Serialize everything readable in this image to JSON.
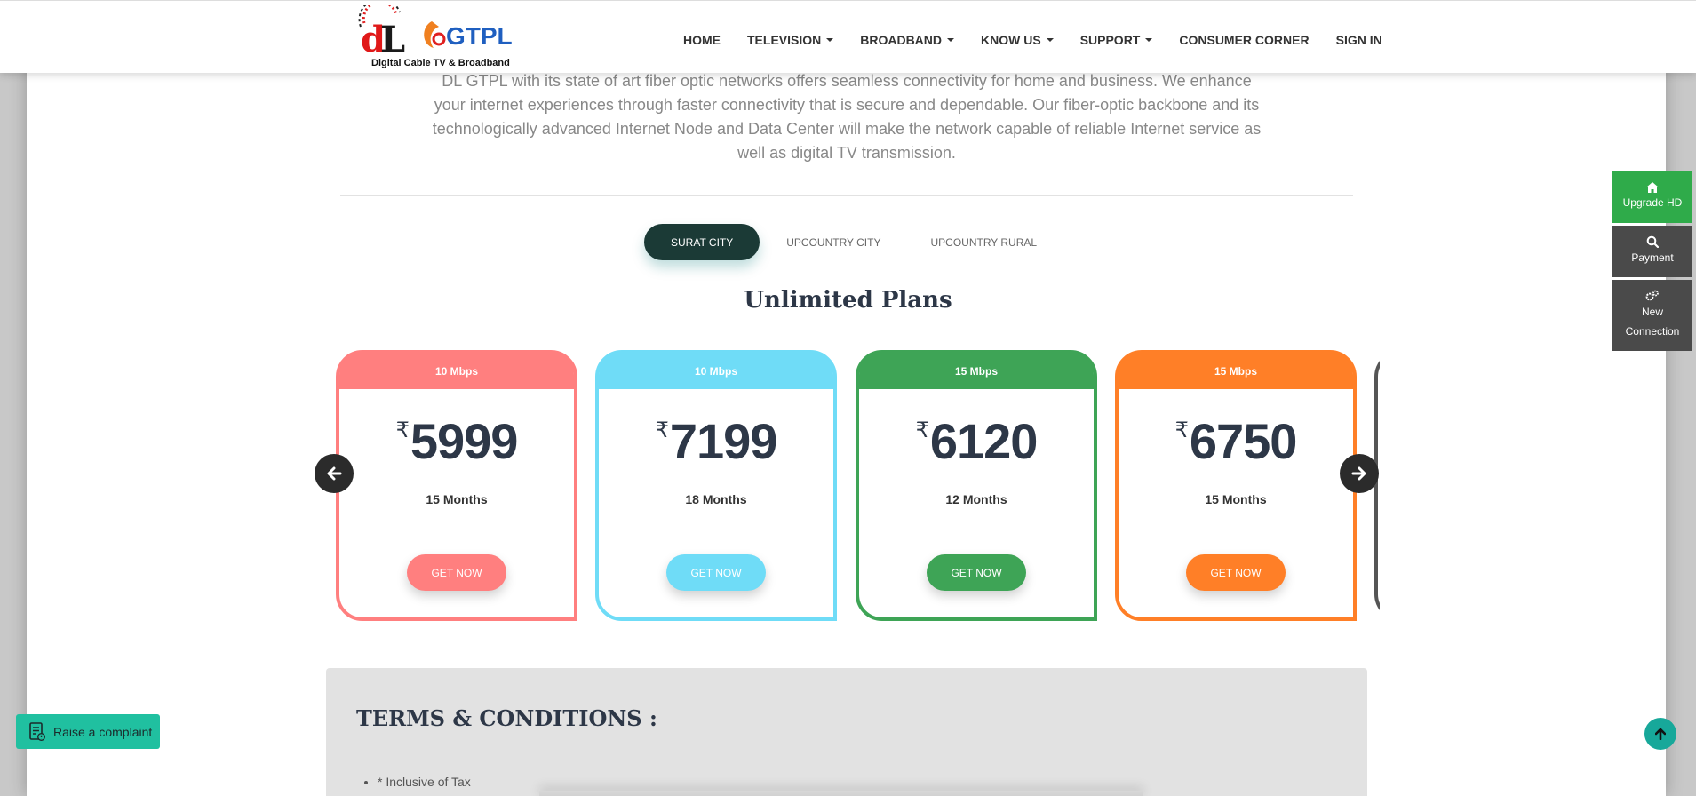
{
  "header": {
    "logo_tagline": "Digital Cable TV & Broadband",
    "logo_text": "GTPL",
    "logo_mark": "dL",
    "nav": [
      {
        "label": "HOME",
        "dropdown": false
      },
      {
        "label": "TELEVISION",
        "dropdown": true
      },
      {
        "label": "BROADBAND",
        "dropdown": true
      },
      {
        "label": "KNOW US",
        "dropdown": true
      },
      {
        "label": "SUPPORT",
        "dropdown": true
      },
      {
        "label": "CONSUMER CORNER",
        "dropdown": false
      },
      {
        "label": "SIGN IN",
        "dropdown": false
      }
    ]
  },
  "intro": "DL GTPL with its state of art fiber optic networks offers seamless connectivity for home and business. We enhance your internet experiences through faster connectivity that is secure and dependable. Our fiber-optic backbone and its technologically advanced Internet Node and Data Center will make the network capable of reliable Internet service as well as digital TV transmission.",
  "tabs": [
    {
      "label": "SURAT CITY",
      "active": true
    },
    {
      "label": "UPCOUNTRY CITY",
      "active": false
    },
    {
      "label": "UPCOUNTRY RURAL",
      "active": false
    }
  ],
  "plans_title": "Unlimited Plans",
  "plans": [
    {
      "speed": "10 Mbps",
      "currency": "₹",
      "price": "5999",
      "duration": "15 Months",
      "button": "GET NOW",
      "color": "#ff7f7f"
    },
    {
      "speed": "10 Mbps",
      "currency": "₹",
      "price": "7199",
      "duration": "18 Months",
      "button": "GET NOW",
      "color": "#6fdcf7"
    },
    {
      "speed": "15 Mbps",
      "currency": "₹",
      "price": "6120",
      "duration": "12 Months",
      "button": "GET NOW",
      "color": "#3ea456"
    },
    {
      "speed": "15 Mbps",
      "currency": "₹",
      "price": "6750",
      "duration": "15 Months",
      "button": "GET NOW",
      "color": "#ff7f27"
    }
  ],
  "terms": {
    "title": "TERMS & CONDITIONS :",
    "items": [
      "* Inclusive of Tax"
    ]
  },
  "side_widget": [
    {
      "icon": "home-icon",
      "label": "Upgrade HD",
      "color": "#2fab4a"
    },
    {
      "icon": "search-icon",
      "label": "Payment",
      "color": "#4a4a4a"
    },
    {
      "icon": "gears-icon",
      "label": "New Connection",
      "color": "#4a4a4a"
    }
  ],
  "complaint_label": "Raise a complaint",
  "colors": {
    "active_tab": "#1b3a36",
    "heading": "#2d3747",
    "complaint": "#20c0a0"
  }
}
